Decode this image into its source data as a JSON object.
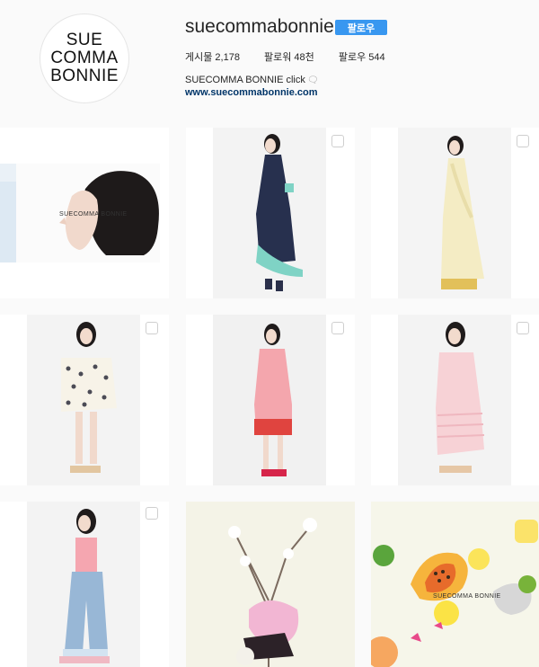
{
  "profile": {
    "avatar_lines": [
      "SUE",
      "COMMA",
      "BONNIE"
    ],
    "username": "suecommabonnie",
    "follow_label": "팔로우",
    "stats": {
      "posts": "게시물 2,178",
      "followers": "팔로워 48천",
      "following": "팔로우 544"
    },
    "bio_name": "SUECOMMA BONNIE click",
    "bio_link": "www.suecommabonnie.com"
  },
  "grid": {
    "tiles": [
      {
        "type": "image",
        "watermark": "SUECOMMA BONNIE",
        "icon": "gallery-square-icon"
      },
      {
        "type": "image",
        "icon": "gallery-square-icon"
      },
      {
        "type": "image",
        "icon": "gallery-square-icon"
      },
      {
        "type": "image",
        "icon": "gallery-square-icon"
      },
      {
        "type": "image",
        "icon": "gallery-square-icon"
      },
      {
        "type": "image",
        "icon": "gallery-square-icon"
      },
      {
        "type": "image",
        "icon": "gallery-square-icon"
      },
      {
        "type": "image",
        "icon": "gallery-square-icon"
      },
      {
        "type": "image",
        "watermark": "SUECOMMA BONNIE",
        "icon": "gallery-square-icon"
      }
    ]
  },
  "colors": {
    "accent": "#3897f0",
    "link": "#003569",
    "background": "#fafafa"
  }
}
